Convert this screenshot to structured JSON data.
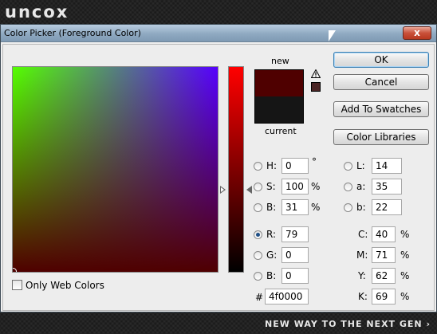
{
  "brand": {
    "logo_text": "uncox",
    "tagline": "NEW WAY TO THE NEXT GEN ›"
  },
  "window": {
    "title": "Color Picker (Foreground Color)",
    "close_glyph": "x"
  },
  "colors": {
    "new": "#4f0000",
    "current": "#151515",
    "gamut_swatch": "#4a2424",
    "accent": "#3c7fb1"
  },
  "swatches": {
    "new_label": "new",
    "current_label": "current"
  },
  "buttons": {
    "ok": "OK",
    "cancel": "Cancel",
    "add_to_swatches": "Add To Swatches",
    "color_libraries": "Color Libraries"
  },
  "fields": {
    "H": {
      "label": "H:",
      "value": "0",
      "unit": "°",
      "selected": false
    },
    "S": {
      "label": "S:",
      "value": "100",
      "unit": "%",
      "selected": false
    },
    "B": {
      "label": "B:",
      "value": "31",
      "unit": "%",
      "selected": false
    },
    "R": {
      "label": "R:",
      "value": "79",
      "selected": true
    },
    "G": {
      "label": "G:",
      "value": "0",
      "selected": false
    },
    "Bl": {
      "label": "B:",
      "value": "0",
      "selected": false
    },
    "L": {
      "label": "L:",
      "value": "14",
      "selected": false
    },
    "a": {
      "label": "a:",
      "value": "35",
      "selected": false
    },
    "b": {
      "label": "b:",
      "value": "22",
      "selected": false
    },
    "C": {
      "label": "C:",
      "value": "40",
      "unit": "%"
    },
    "M": {
      "label": "M:",
      "value": "71",
      "unit": "%"
    },
    "Y": {
      "label": "Y:",
      "value": "62",
      "unit": "%"
    },
    "K": {
      "label": "K:",
      "value": "69",
      "unit": "%"
    },
    "hex": {
      "label": "#",
      "value": "4f0000"
    }
  },
  "only_web_colors": {
    "label": "Only Web Colors",
    "checked": false
  },
  "icons": {
    "warning": "warning-icon",
    "close": "close-icon",
    "cursor": "cursor-icon"
  }
}
